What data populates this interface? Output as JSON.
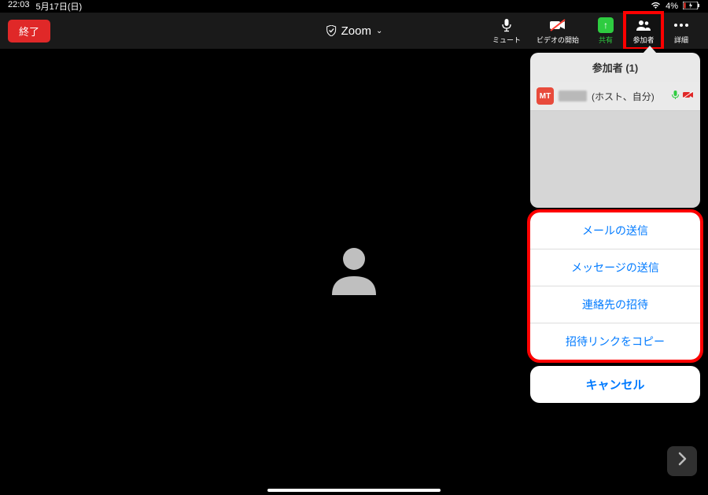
{
  "status": {
    "time": "22:03",
    "date": "5月17日(日)",
    "battery": "4%"
  },
  "toolbar": {
    "end_label": "終了",
    "title": "Zoom",
    "mute_label": "ミュート",
    "video_label": "ビデオの開始",
    "share_label": "共有",
    "participants_label": "参加者",
    "more_label": "詳細"
  },
  "panel": {
    "title": "参加者 (1)",
    "participants": [
      {
        "initials": "MT",
        "suffix": "(ホスト、自分)"
      }
    ]
  },
  "actions": {
    "items": [
      "メールの送信",
      "メッセージの送信",
      "連絡先の招待",
      "招待リンクをコピー"
    ],
    "cancel": "キャンセル"
  }
}
